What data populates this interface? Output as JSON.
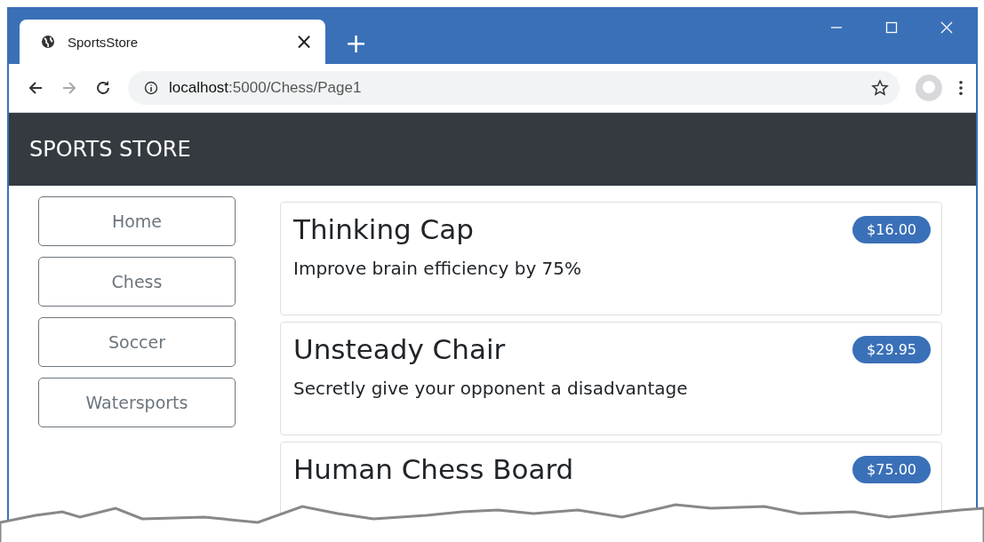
{
  "browser": {
    "tab": {
      "title": "SportsStore",
      "close": "×"
    },
    "new_tab": "+",
    "address": {
      "host": "localhost",
      "rest": ":5000/Chess/Page1"
    }
  },
  "navbar": {
    "brand": "SPORTS STORE"
  },
  "categories": [
    {
      "label": "Home",
      "selected": false
    },
    {
      "label": "Chess",
      "selected": false
    },
    {
      "label": "Soccer",
      "selected": false
    },
    {
      "label": "Watersports",
      "selected": false
    }
  ],
  "products": [
    {
      "name": "Thinking Cap",
      "price": "$16.00",
      "description": "Improve brain efficiency by 75%"
    },
    {
      "name": "Unsteady Chair",
      "price": "$29.95",
      "description": "Secretly give your opponent a disadvantage"
    },
    {
      "name": "Human Chess Board",
      "price": "$75.00"
    }
  ]
}
